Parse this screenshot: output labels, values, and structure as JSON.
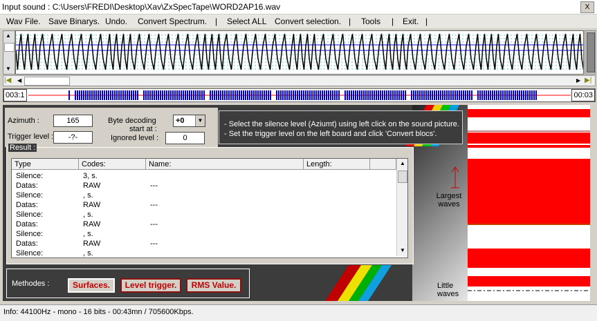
{
  "title": "Input sound : C:\\Users\\FREDI\\Desktop\\Xav\\ZxSpecTape\\WORD2AP16.wav",
  "close_label": "X",
  "menu": [
    "Wav File.",
    "Save Binarys.",
    "Undo.",
    "Convert Spectrum.",
    "|",
    "Select ALL",
    "Convert selection.",
    "|",
    "Tools",
    "|",
    "Exit.",
    "|"
  ],
  "timeline": {
    "start": "003:1",
    "end": "00:03"
  },
  "params": {
    "azimuth_label": "Azimuth :",
    "azimuth_value": "165",
    "trigger_label": "Trigger level :",
    "trigger_value": "-?-",
    "byte_decoding_label": "Byte decoding",
    "start_at_label": "start at :",
    "byte_start_value": "+0",
    "ignored_label": "Ignored level :",
    "ignored_value": "0"
  },
  "info_lines": [
    "- Select the silence level (Aziumt) using left click on the sound picture.",
    "- Set the trigger level on the left board and click 'Convert blocs'."
  ],
  "result": {
    "label": "Result :",
    "headers": [
      "Type",
      "Codes:",
      "Name:",
      "Length:"
    ],
    "rows": [
      [
        "Silence:",
        "3, s.",
        "",
        ""
      ],
      [
        "Datas:",
        "RAW",
        "---",
        ""
      ],
      [
        "Silence:",
        ", s.",
        "",
        ""
      ],
      [
        "Datas:",
        "RAW",
        "---",
        ""
      ],
      [
        "Silence:",
        ", s.",
        "",
        ""
      ],
      [
        "Datas:",
        "RAW",
        "---",
        ""
      ],
      [
        "Silence:",
        ", s.",
        "",
        ""
      ],
      [
        "Datas:",
        "RAW",
        "---",
        ""
      ],
      [
        "Silence:",
        ", s.",
        "",
        ""
      ]
    ]
  },
  "methodes": {
    "label": "Methodes :",
    "buttons": [
      "Surfaces.",
      "Level trigger.",
      "RMS Value."
    ]
  },
  "largest_waves": [
    "Largest",
    "waves"
  ],
  "little_waves": [
    "Little",
    "waves"
  ],
  "status": "Info: 44100Hz - mono - 16 bits - 00:43mn / 705600Kbps.",
  "colors": {
    "accent_red": "#ff0000",
    "signal_blue": "#0000ff",
    "dark_panel": "#3c3c3c"
  }
}
